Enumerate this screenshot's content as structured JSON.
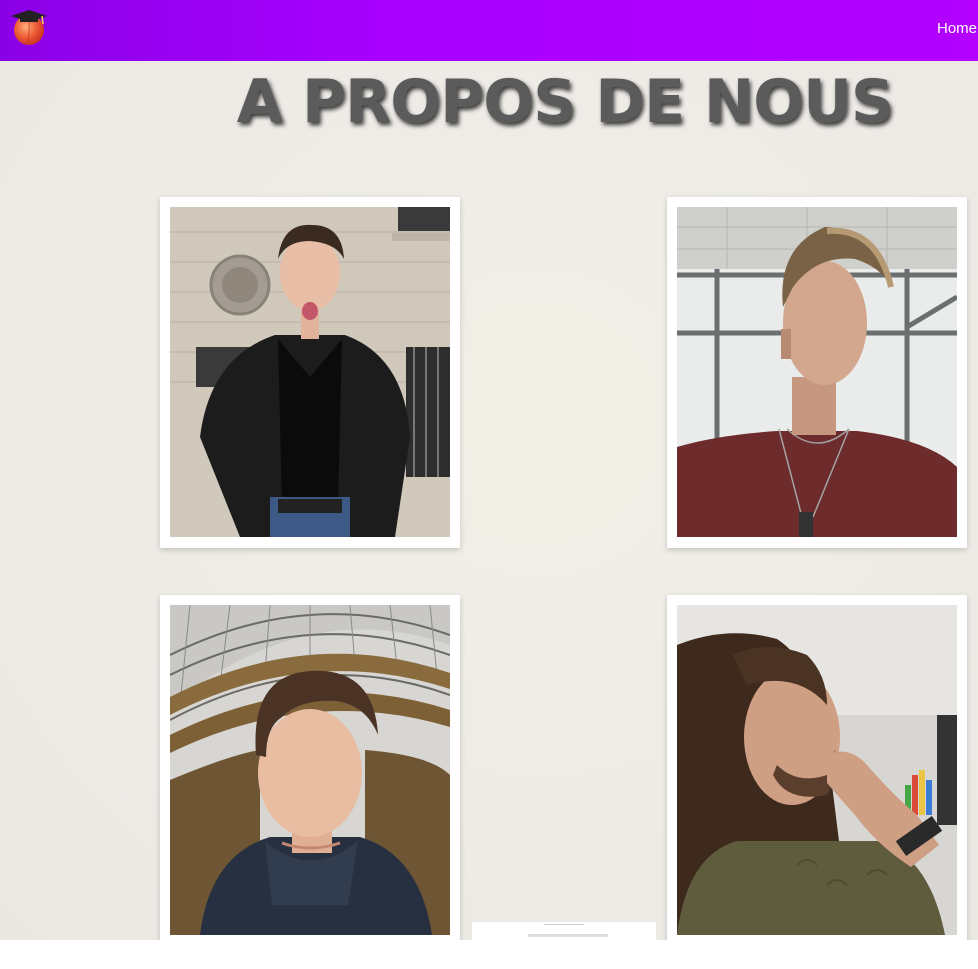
{
  "navbar": {
    "logo_icon": "peach-graduation-cap-logo-icon",
    "links": [
      {
        "label": "Home"
      }
    ],
    "gradient": [
      "#8a00e6",
      "#b300ff"
    ]
  },
  "page": {
    "title": "A PROPOS DE NOUS"
  },
  "team": [
    {
      "photo": "portrait-photo-1"
    },
    {
      "photo": "portrait-photo-2"
    },
    {
      "photo": "portrait-photo-3"
    },
    {
      "photo": "portrait-photo-4"
    }
  ],
  "colors": {
    "title": "#5b5b5b",
    "background": "#efece7",
    "card": "#ffffff"
  }
}
